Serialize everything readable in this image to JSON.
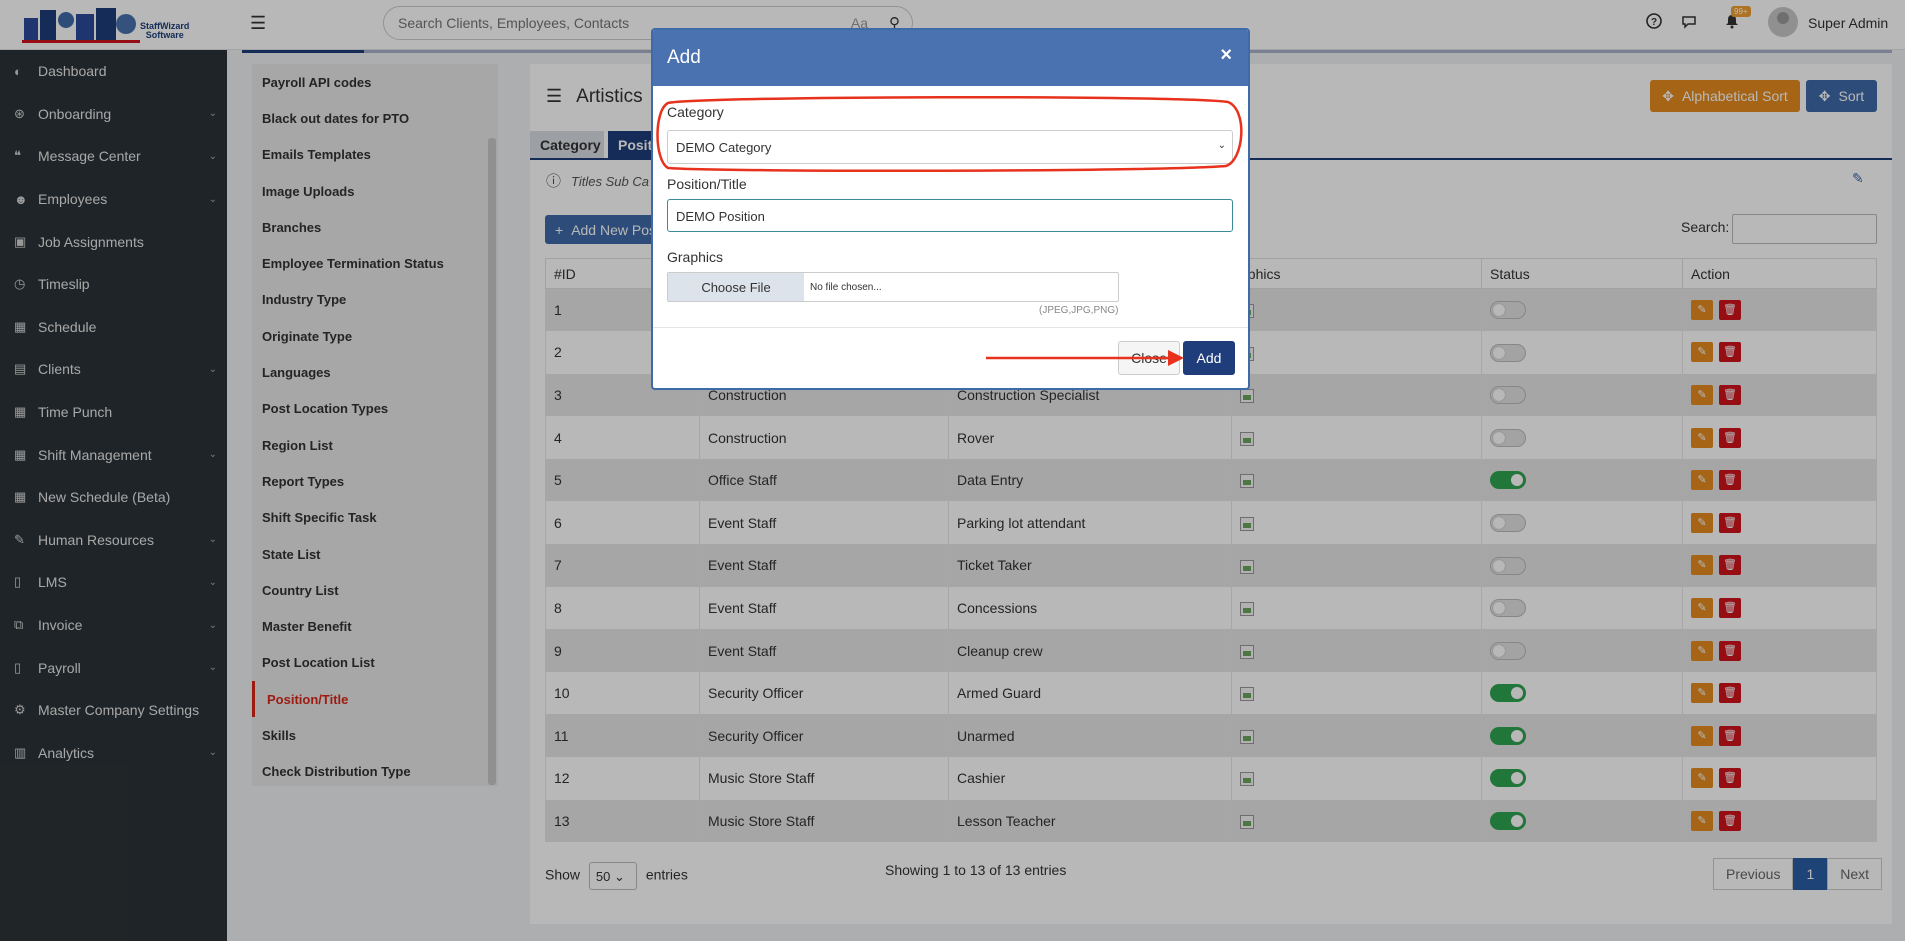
{
  "header": {
    "brand_line1": "StaffWizard",
    "brand_line2": "Software",
    "search_placeholder": "Search Clients, Employees, Contacts",
    "search_aa": "Aa",
    "notif_badge": "99+",
    "user_name": "Super Admin"
  },
  "sidebar": {
    "items": [
      {
        "label": "Dashboard",
        "icon": "palette-icon",
        "chevron": false
      },
      {
        "label": "Onboarding",
        "icon": "handshake-icon",
        "chevron": true
      },
      {
        "label": "Message Center",
        "icon": "comments-icon",
        "chevron": true
      },
      {
        "label": "Employees",
        "icon": "users-icon",
        "chevron": true
      },
      {
        "label": "Job Assignments",
        "icon": "briefcase-icon",
        "chevron": false
      },
      {
        "label": "Timeslip",
        "icon": "clock-icon",
        "chevron": false
      },
      {
        "label": "Schedule",
        "icon": "calendar-icon",
        "chevron": false
      },
      {
        "label": "Clients",
        "icon": "building-icon",
        "chevron": true
      },
      {
        "label": "Time Punch",
        "icon": "calendar-icon",
        "chevron": false
      },
      {
        "label": "Shift Management",
        "icon": "calendar-check-icon",
        "chevron": true
      },
      {
        "label": "New Schedule (Beta)",
        "icon": "calendar-icon",
        "chevron": false
      },
      {
        "label": "Human Resources",
        "icon": "pen-icon",
        "chevron": true
      },
      {
        "label": "LMS",
        "icon": "file-icon",
        "chevron": true
      },
      {
        "label": "Invoice",
        "icon": "copy-icon",
        "chevron": true
      },
      {
        "label": "Payroll",
        "icon": "file-icon",
        "chevron": true
      },
      {
        "label": "Master Company Settings",
        "icon": "cogs-icon",
        "chevron": false
      },
      {
        "label": "Analytics",
        "icon": "bar-chart-icon",
        "chevron": true
      }
    ]
  },
  "settings_list": [
    "Payroll API codes",
    "Black out dates for PTO",
    "Emails Templates",
    "Image Uploads",
    "Branches",
    "Employee Termination Status",
    "Industry Type",
    "Originate Type",
    "Languages",
    "Post Location Types",
    "Region List",
    "Report Types",
    "Shift Specific Task",
    "State List",
    "Country List",
    "Master Benefit",
    "Post Location List",
    "Position/Title",
    "Skills",
    "Check Distribution Type"
  ],
  "settings_active_index": 17,
  "page": {
    "title": "Artistics",
    "alpha_sort": "Alphabetical Sort",
    "sort": "Sort",
    "tab_category": "Category",
    "tab_position": "Positi",
    "info_text": "Titles Sub Ca",
    "add_new": "Add New Pos",
    "search_label": "Search:"
  },
  "table": {
    "columns": [
      "#ID",
      "",
      "",
      "aphics",
      "Status",
      "Action"
    ],
    "rows": [
      {
        "id": "1",
        "category": "",
        "position": "",
        "on": false
      },
      {
        "id": "2",
        "category": "",
        "position": "",
        "on": false
      },
      {
        "id": "3",
        "category": "Construction",
        "position": "Construction Specialist",
        "on": false
      },
      {
        "id": "4",
        "category": "Construction",
        "position": "Rover",
        "on": false
      },
      {
        "id": "5",
        "category": "Office Staff",
        "position": "Data Entry",
        "on": true
      },
      {
        "id": "6",
        "category": "Event Staff",
        "position": "Parking lot attendant",
        "on": false
      },
      {
        "id": "7",
        "category": "Event Staff",
        "position": "Ticket Taker",
        "on": false
      },
      {
        "id": "8",
        "category": "Event Staff",
        "position": "Concessions",
        "on": false
      },
      {
        "id": "9",
        "category": "Event Staff",
        "position": "Cleanup crew",
        "on": false
      },
      {
        "id": "10",
        "category": "Security Officer",
        "position": "Armed Guard",
        "on": true
      },
      {
        "id": "11",
        "category": "Security Officer",
        "position": "Unarmed",
        "on": true
      },
      {
        "id": "12",
        "category": "Music Store Staff",
        "position": "Cashier",
        "on": true
      },
      {
        "id": "13",
        "category": "Music Store Staff",
        "position": "Lesson Teacher",
        "on": true
      }
    ]
  },
  "footer": {
    "show": "Show",
    "entries_value": "50",
    "entries": "entries",
    "showing": "Showing 1 to 13 of 13 entries",
    "prev": "Previous",
    "page": "1",
    "next": "Next"
  },
  "modal": {
    "title": "Add",
    "close_x": "×",
    "category_label": "Category",
    "category_value": "DEMO Category",
    "position_label": "Position/Title",
    "position_value": "DEMO Position",
    "graphics_label": "Graphics",
    "choose_file": "Choose File",
    "no_file": "No file chosen...",
    "file_hint": "(JPEG,JPG,PNG)",
    "close_btn": "Close",
    "add_btn": "Add"
  },
  "colors": {
    "sidebar_bg": "#2c3338",
    "primary": "#1f3d7a",
    "modal_header": "#4a72b0",
    "orange": "#e58b1f",
    "danger": "#d0141c",
    "annotation_red": "#e8321e"
  }
}
